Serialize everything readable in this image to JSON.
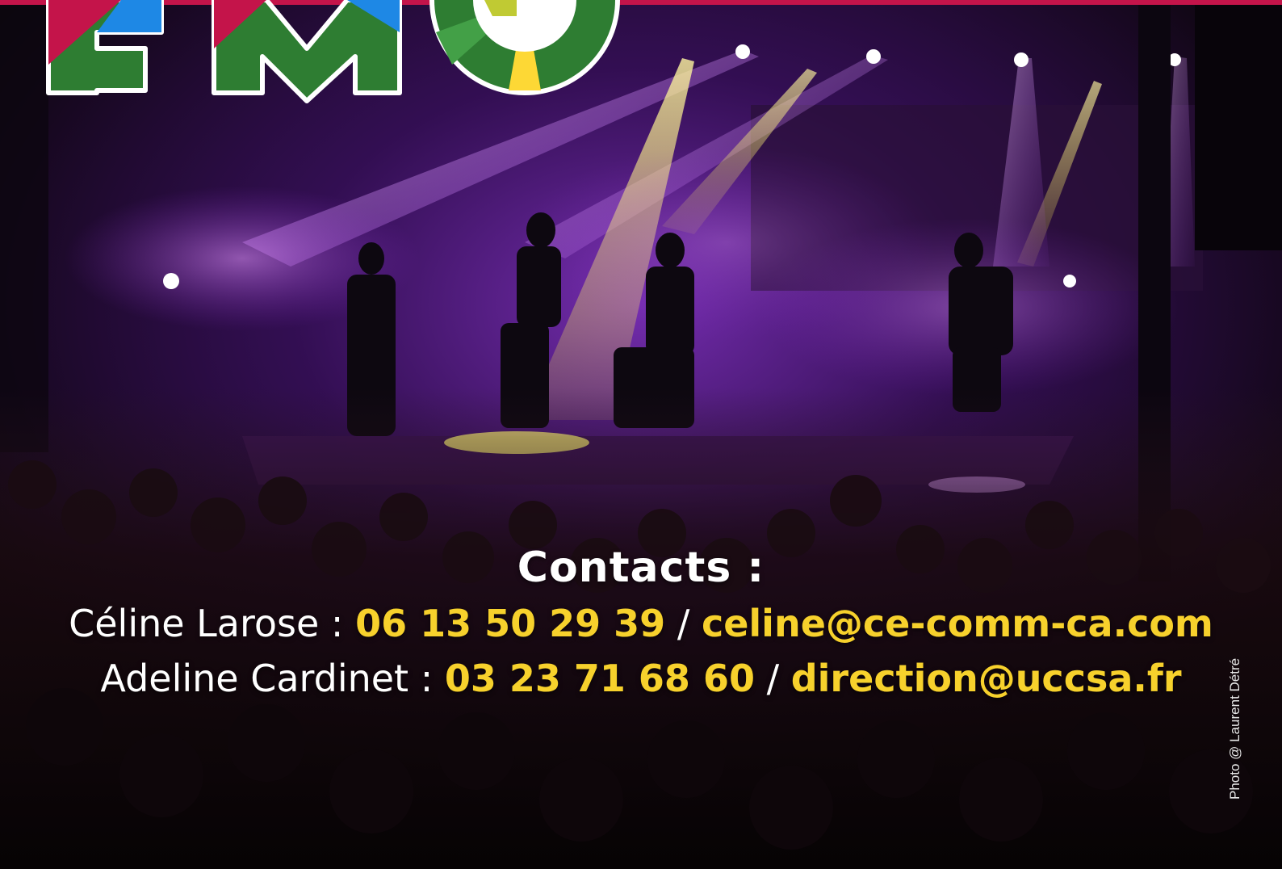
{
  "logo": {
    "text": "FMO"
  },
  "contacts": {
    "title": "Contacts :",
    "people": [
      {
        "name": "Céline Larose",
        "separator": " : ",
        "phone": "06 13 50 29 39",
        "divider": " / ",
        "email": "celine@ce-comm-ca.com"
      },
      {
        "name": "Adeline Cardinet",
        "separator": " : ",
        "phone": "03 23 71 68 60",
        "divider": " / ",
        "email": "direction@uccsa.fr"
      }
    ]
  },
  "credit": "Photo @ Laurent Détré",
  "colors": {
    "accent_bar": "#c4144a",
    "highlight": "#f7d12c",
    "text": "#ffffff",
    "logo_green": "#2e7d32",
    "logo_red": "#c4144a",
    "logo_blue": "#1e88e5",
    "logo_yellow": "#fdd835"
  }
}
